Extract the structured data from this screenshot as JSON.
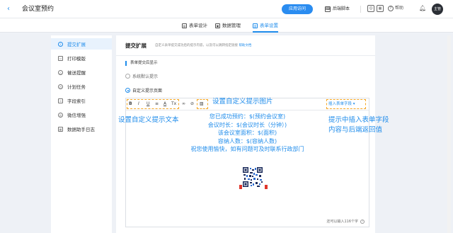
{
  "header": {
    "back_icon": "chevron-left-icon",
    "title": "会议室预约",
    "publish_label": "应用访问",
    "script_label": "后端脚本",
    "help_label": "帮助",
    "avatar_text": "主管"
  },
  "tabs": [
    {
      "label": "表单设计",
      "icon": "form-icon"
    },
    {
      "label": "数据管理",
      "icon": "data-icon"
    },
    {
      "label": "表单设置",
      "icon": "settings-icon",
      "active": true
    }
  ],
  "sidebar": {
    "items": [
      {
        "label": "提交扩展",
        "icon": "info-icon",
        "active": true
      },
      {
        "label": "打印模版",
        "icon": "print-icon"
      },
      {
        "label": "催送提醒",
        "icon": "bell-icon"
      },
      {
        "label": "计划任务",
        "icon": "clock-icon"
      },
      {
        "label": "字段索引",
        "icon": "index-icon"
      },
      {
        "label": "微信增强",
        "icon": "wechat-icon"
      },
      {
        "label": "数据助手日志",
        "icon": "log-icon"
      }
    ]
  },
  "panel": {
    "title": "提交扩展",
    "description": "自定义表单提交成功后的提示内容，以及可以跳转指定链接",
    "description_link": "帮助文档",
    "section_title": "表单提交后显示",
    "radio_default": "系统默认提示",
    "radio_custom": "自定义提示页面",
    "insert_field_label": "插入表单字段",
    "toolbar_buttons": [
      "B",
      "I",
      "U",
      "≡",
      "A",
      "Tx"
    ],
    "editor_lines": [
      "您已成功预约：$(预约会议室)",
      "会议时长：$(会议时长（分钟）)",
      "该会议室面积：$(面积)",
      "容纳人数：$(容纳人数)",
      "祝您使用愉快，如有问题可及时联系行政部门"
    ],
    "counter_text": "还可以输入116个字"
  },
  "annotations": {
    "text_label": "设置自定义提示文本",
    "image_label": "设置自定义提示图片",
    "field_label_line1": "提示中插入表单字段",
    "field_label_line2": "内容与后端返回值"
  },
  "colors": {
    "accent": "#1f8ceb",
    "annotation_box": "#f5a623"
  }
}
